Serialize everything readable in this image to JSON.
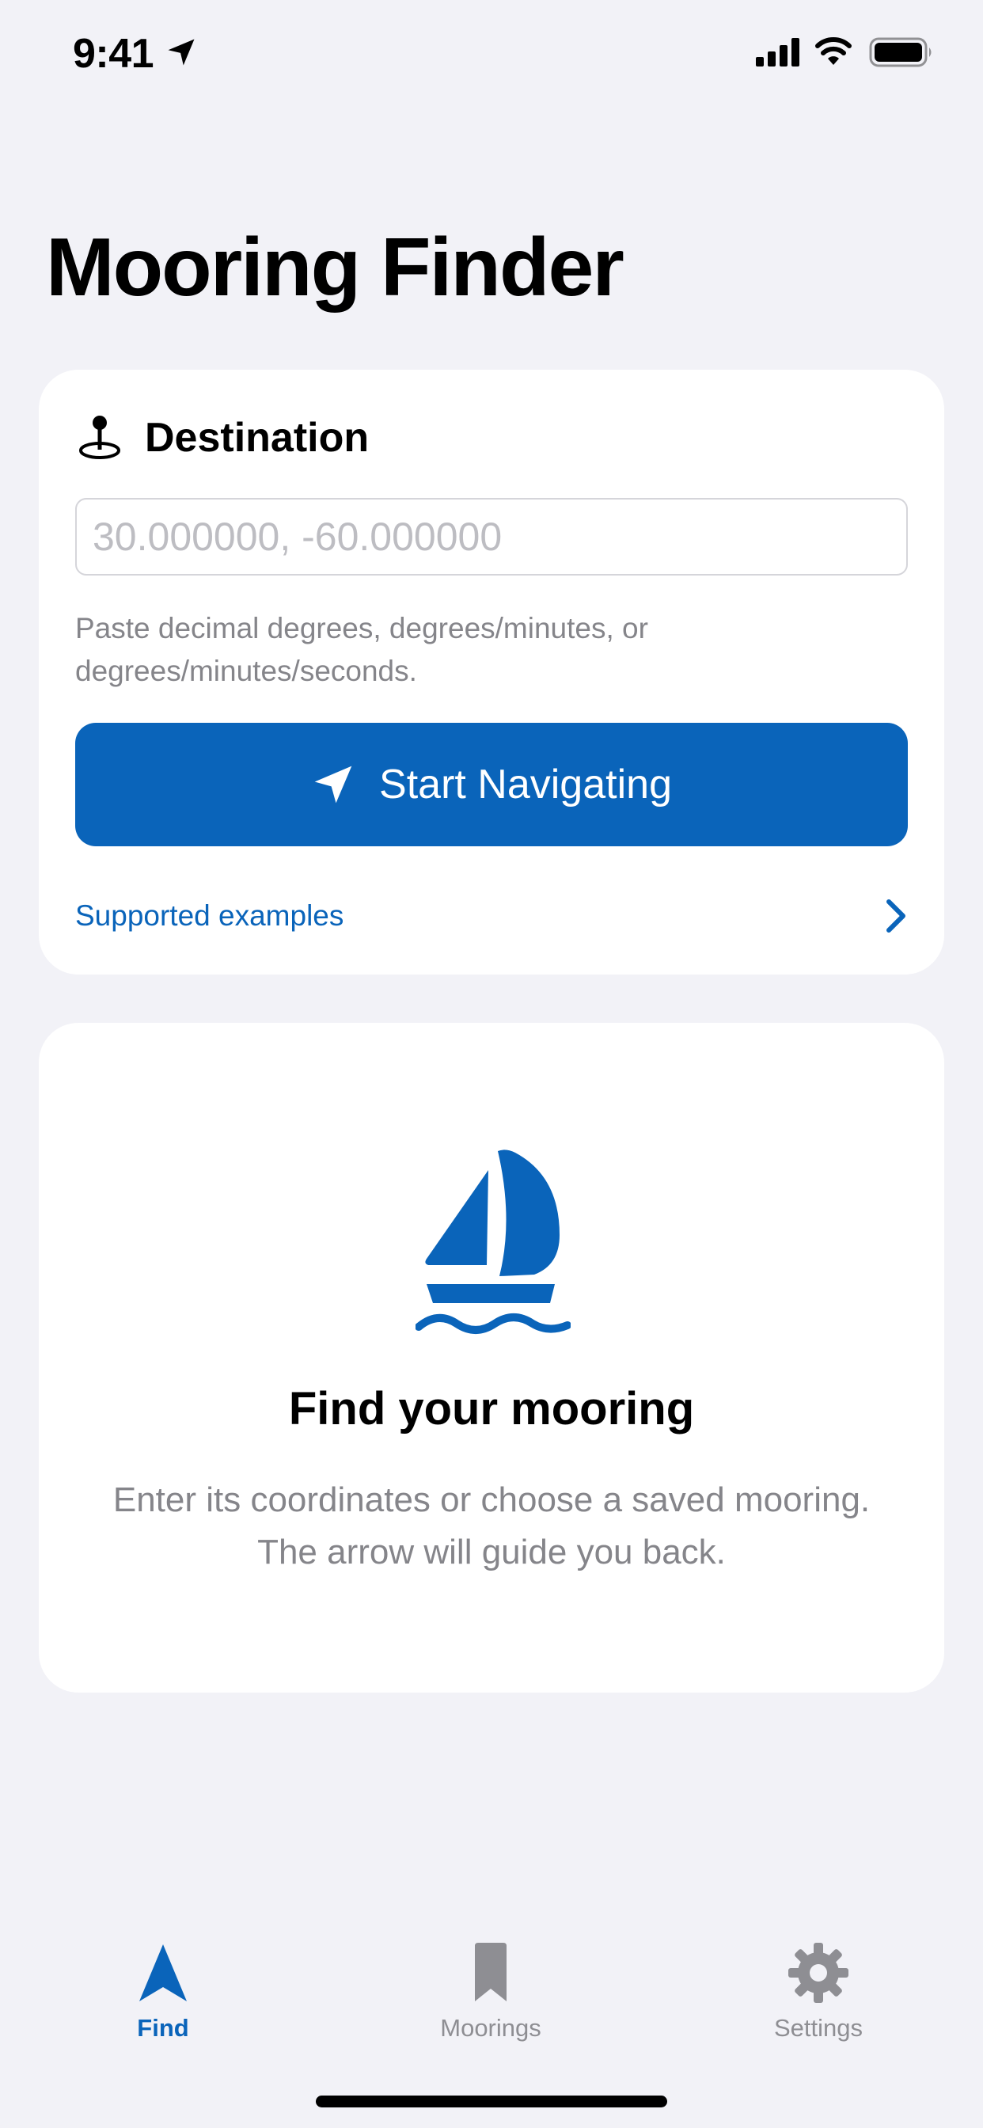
{
  "status_bar": {
    "time": "9:41",
    "icons": [
      "location-arrow-icon",
      "cellular-signal-icon",
      "wifi-icon",
      "battery-icon"
    ]
  },
  "page": {
    "title": "Mooring Finder"
  },
  "destination_card": {
    "icon": "map-pin-icon",
    "title": "Destination",
    "input": {
      "value": "",
      "placeholder": "30.000000, -60.000000"
    },
    "helper_text": "Paste decimal degrees, degrees/minutes, or degrees/minutes/seconds.",
    "start_button": {
      "icon": "navigation-arrow-icon",
      "label": "Start Navigating"
    },
    "examples_link": {
      "label": "Supported examples",
      "icon": "chevron-right-icon"
    }
  },
  "empty_state": {
    "icon": "sailboat-icon",
    "title": "Find your mooring",
    "body": "Enter its coordinates or choose a saved mooring. The arrow will guide you back."
  },
  "tab_bar": {
    "selected": "Find",
    "tabs": [
      {
        "label": "Find",
        "icon": "compass-arrow-icon"
      },
      {
        "label": "Moorings",
        "icon": "bookmark-icon"
      },
      {
        "label": "Settings",
        "icon": "gear-icon"
      }
    ]
  },
  "colors": {
    "accent": "#0A64BA",
    "background": "#F2F2F7",
    "card": "#FFFFFF",
    "secondary_text": "#85858A",
    "inactive_tab": "#8E8E93"
  }
}
